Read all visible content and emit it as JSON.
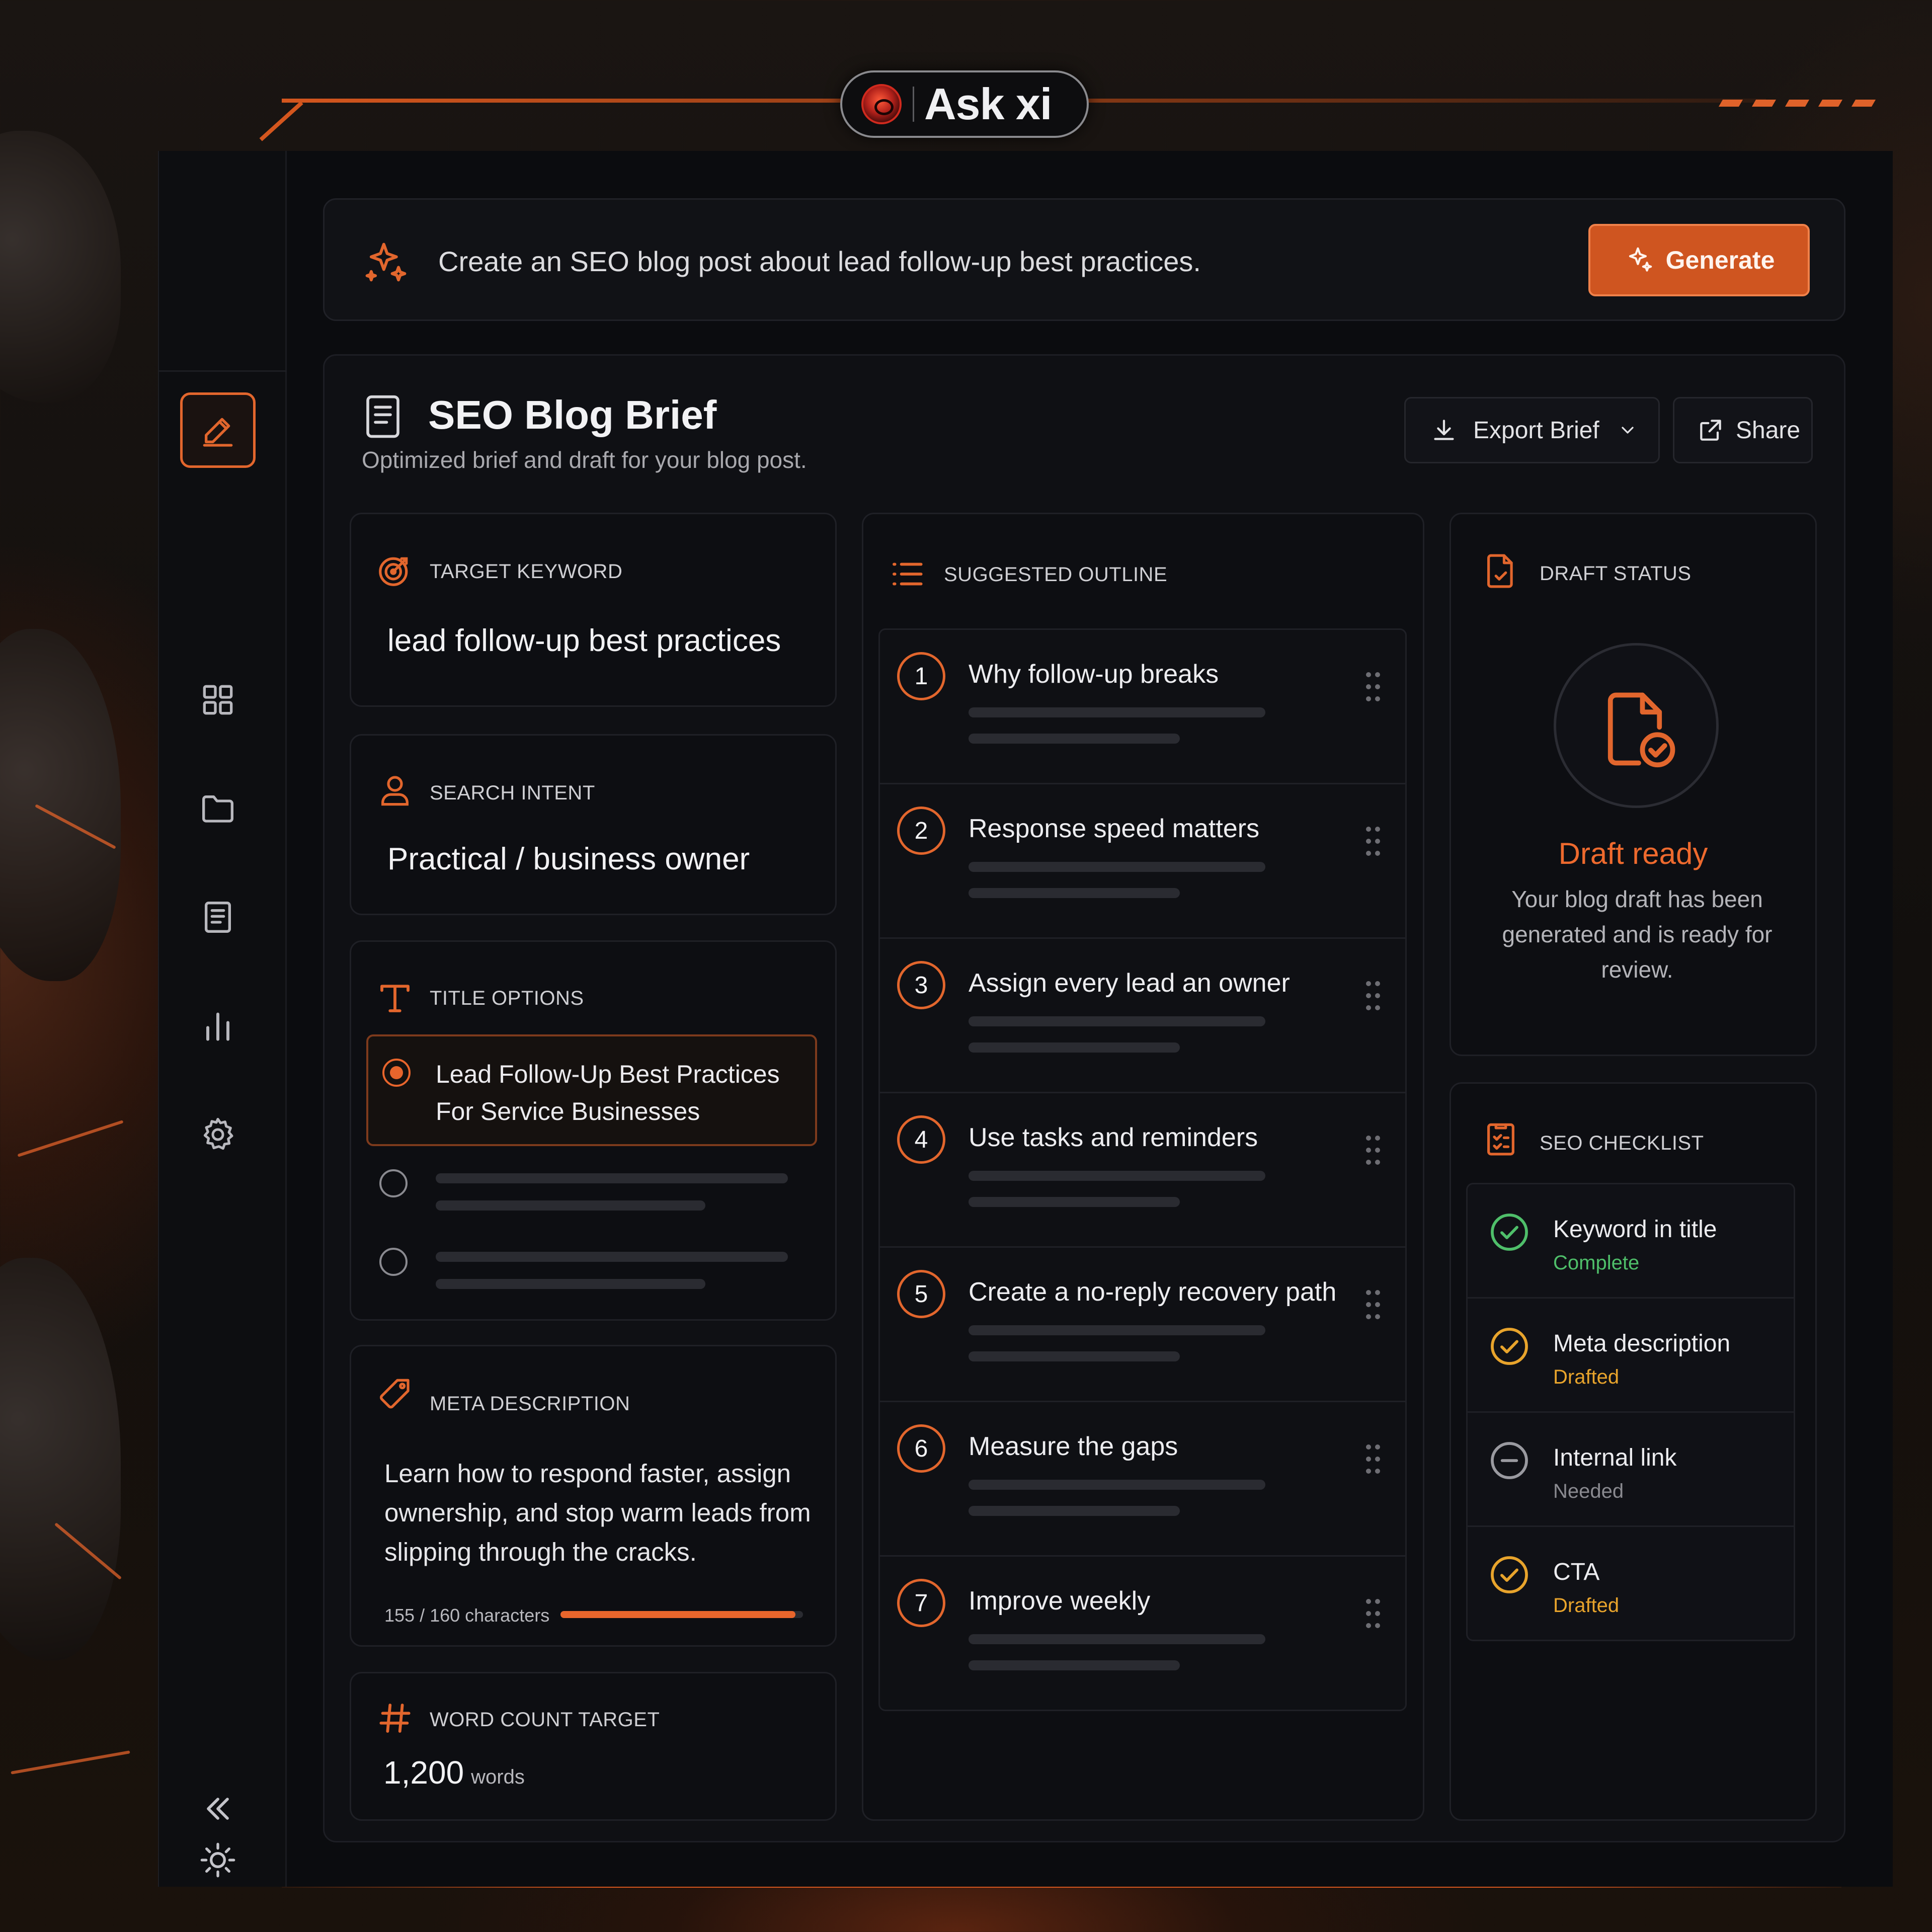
{
  "brand": {
    "name": "Ask xi"
  },
  "prompt": {
    "text": "Create an SEO blog post about lead follow-up best practices.",
    "generate_label": "Generate"
  },
  "sidebar": {
    "items": [
      {
        "name": "edit",
        "icon": "pencil-square-icon",
        "active": true
      },
      {
        "name": "dashboard",
        "icon": "grid-icon"
      },
      {
        "name": "files",
        "icon": "folder-icon"
      },
      {
        "name": "documents",
        "icon": "document-icon"
      },
      {
        "name": "analytics",
        "icon": "bar-chart-icon"
      },
      {
        "name": "settings",
        "icon": "gear-icon"
      }
    ],
    "bottom": [
      {
        "name": "theme",
        "icon": "sun-icon"
      },
      {
        "name": "collapse",
        "icon": "double-chevron-left-icon"
      }
    ]
  },
  "brief": {
    "title": "SEO Blog Brief",
    "subtitle": "Optimized brief and draft for your blog post.",
    "export_label": "Export Brief",
    "share_label": "Share"
  },
  "target_keyword": {
    "label": "TARGET KEYWORD",
    "value": "lead follow-up best practices"
  },
  "search_intent": {
    "label": "SEARCH INTENT",
    "value": "Practical / business owner"
  },
  "title_options": {
    "label": "TITLE OPTIONS",
    "selected": "Lead Follow-Up Best Practices For Service Businesses"
  },
  "meta_description": {
    "label": "META DESCRIPTION",
    "text": "Learn how to respond faster, assign ownership, and stop warm leads from slipping through the cracks.",
    "count_text": "155 / 160 characters",
    "count": 155,
    "max": 160
  },
  "word_count": {
    "label": "WORD COUNT TARGET",
    "value": "1,200",
    "unit": "words"
  },
  "outline": {
    "label": "SUGGESTED OUTLINE",
    "items": [
      {
        "num": "1",
        "title": "Why follow-up breaks"
      },
      {
        "num": "2",
        "title": "Response speed matters"
      },
      {
        "num": "3",
        "title": "Assign every lead an owner"
      },
      {
        "num": "4",
        "title": "Use tasks and reminders"
      },
      {
        "num": "5",
        "title": "Create a no-reply recovery path"
      },
      {
        "num": "6",
        "title": "Measure the gaps"
      },
      {
        "num": "7",
        "title": "Improve weekly"
      }
    ]
  },
  "draft_status": {
    "label": "DRAFT STATUS",
    "state": "Draft ready",
    "description": "Your blog draft has been generated and is ready for review."
  },
  "seo_checklist": {
    "label": "SEO CHECKLIST",
    "items": [
      {
        "title": "Keyword in title",
        "status": "Complete",
        "color": "#4fbf6a"
      },
      {
        "title": "Meta description",
        "status": "Drafted",
        "color": "#e8a42c"
      },
      {
        "title": "Internal link",
        "status": "Needed",
        "color": "#8a8a90"
      },
      {
        "title": "CTA",
        "status": "Drafted",
        "color": "#e8a42c"
      }
    ]
  },
  "colors": {
    "accent": "#e2662d",
    "background": "#0b0c0f",
    "complete": "#4fbf6a",
    "drafted": "#e8a42c"
  }
}
